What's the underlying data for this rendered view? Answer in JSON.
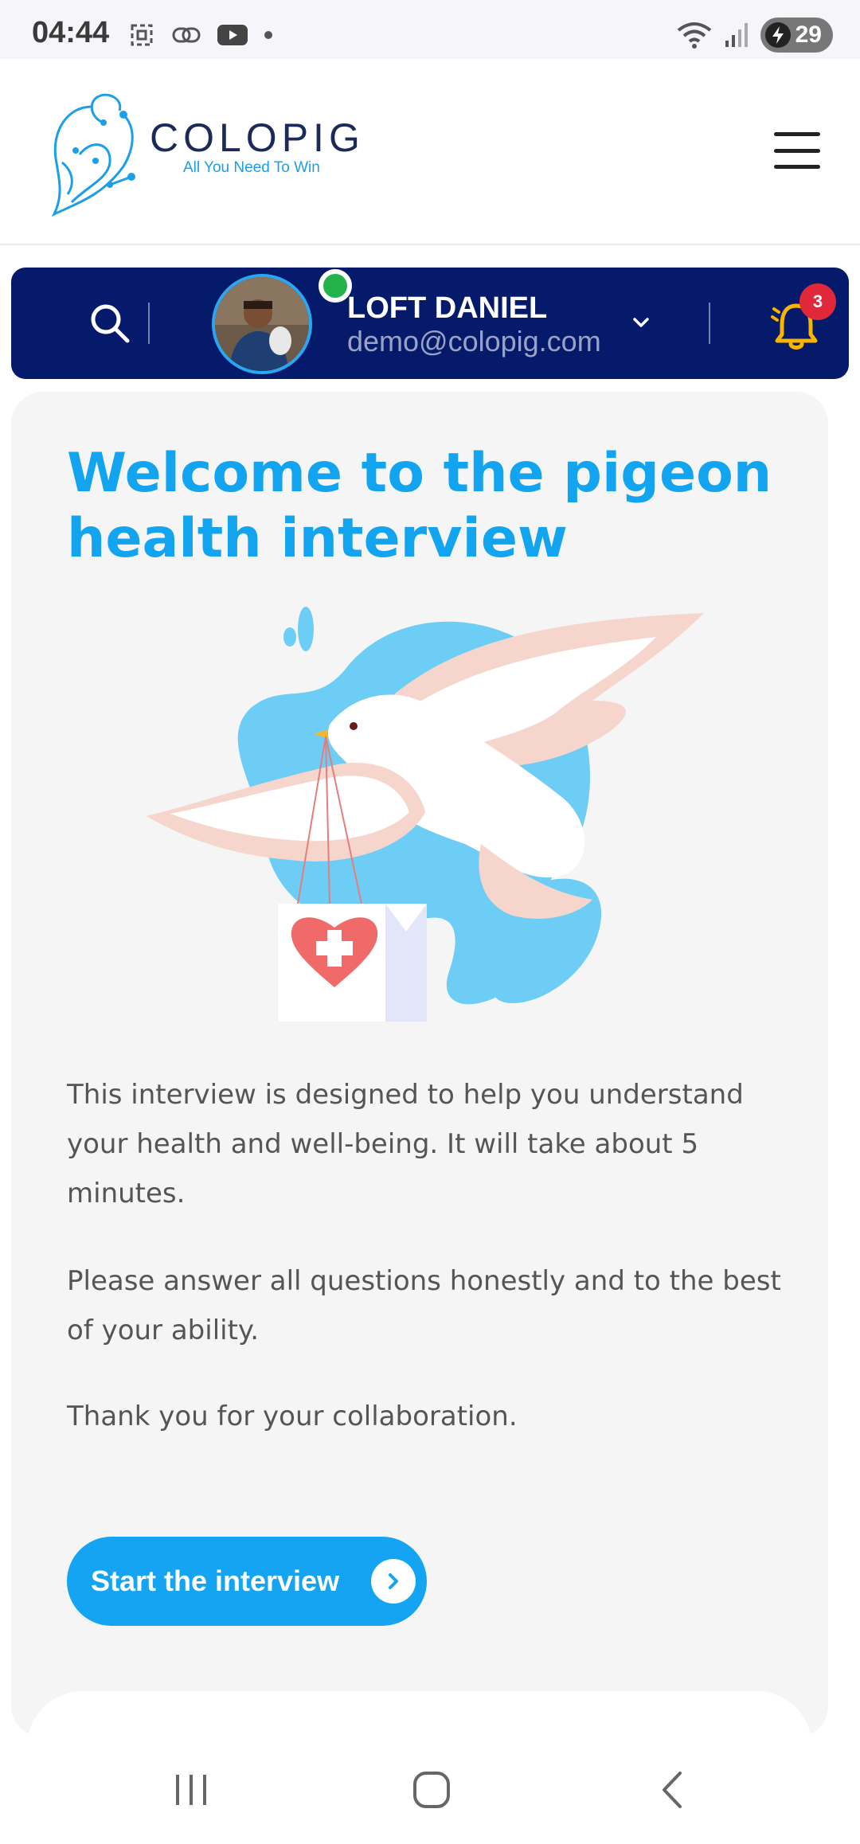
{
  "status_bar": {
    "time": "04:44",
    "battery_level": "29",
    "icons": [
      "screenshot-icon",
      "link-icon",
      "youtube-icon",
      "dot-icon",
      "wifi-icon",
      "signal-icon",
      "battery-charging-icon"
    ]
  },
  "header": {
    "logo_name": "COLOPIG",
    "logo_tagline": "All You Need To Win",
    "menu_icon": "hamburger-menu-icon",
    "colors": {
      "brand_blue": "#1a9fe8",
      "brand_navy": "#1c2a5a"
    }
  },
  "user_bar": {
    "name": "LOFT DANIEL",
    "email": "demo@colopig.com",
    "notification_count": "3",
    "online": true,
    "colors": {
      "background": "#061a6b",
      "bell": "#f7b500",
      "badge": "#e0283a",
      "online": "#23b24b"
    }
  },
  "main": {
    "title": "Welcome to the pigeon health interview",
    "paragraph_1": "This interview is designed to help you understand your health and well-being. It will take about 5 minutes.",
    "paragraph_2": "Please answer all questions honestly and to the best of your ability.",
    "paragraph_3": "Thank you for your collaboration.",
    "start_button_label": "Start the interview",
    "colors": {
      "title": "#13a4ef",
      "button": "#14a4f2"
    }
  },
  "nav_bar": {
    "items": [
      "recent-apps-icon",
      "home-icon",
      "back-icon"
    ]
  }
}
